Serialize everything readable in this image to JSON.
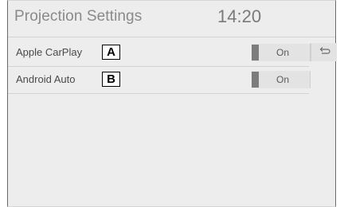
{
  "header": {
    "title": "Projection Settings",
    "clock": "14:20"
  },
  "settings": [
    {
      "label": "Apple CarPlay",
      "value": "On",
      "callout": "A"
    },
    {
      "label": "Android Auto",
      "value": "On",
      "callout": "B"
    }
  ],
  "icons": {
    "back": "return-arrow-icon"
  }
}
